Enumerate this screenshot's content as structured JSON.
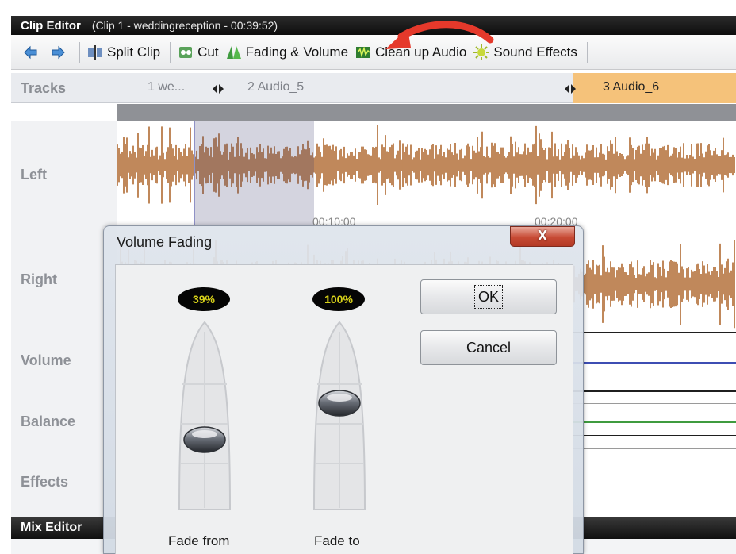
{
  "window": {
    "title": "Clip Editor",
    "subtitle": "(Clip 1 - weddingreception - 00:39:52)"
  },
  "toolbar": {
    "split_clip": "Split Clip",
    "cut": "Cut",
    "fading_volume": "Fading & Volume",
    "clean_up_audio": "Clean up Audio",
    "sound_effects": "Sound Effects"
  },
  "tracks": {
    "label": "Tracks",
    "items": [
      {
        "label": "1 we..."
      },
      {
        "label": "2 Audio_5"
      },
      {
        "label": "3 Audio_6"
      }
    ],
    "accent_color": "#f5c27a"
  },
  "lanes": {
    "left": "Left",
    "right": "Right",
    "volume": "Volume",
    "balance": "Balance",
    "effects": "Effects"
  },
  "timeline": {
    "tick_1": "00:10:00",
    "tick_2": "00:20:00"
  },
  "waveform_color": "#b06b32",
  "mix_editor": {
    "label": "Mix Editor"
  },
  "dialog": {
    "title": "Volume Fading",
    "close_label": "X",
    "fade_from": {
      "label": "Fade from",
      "value_text": "39%",
      "level": 0.39
    },
    "fade_to": {
      "label": "Fade to",
      "value_text": "100%",
      "level": 1.0
    },
    "ok_label": "OK",
    "cancel_label": "Cancel"
  }
}
